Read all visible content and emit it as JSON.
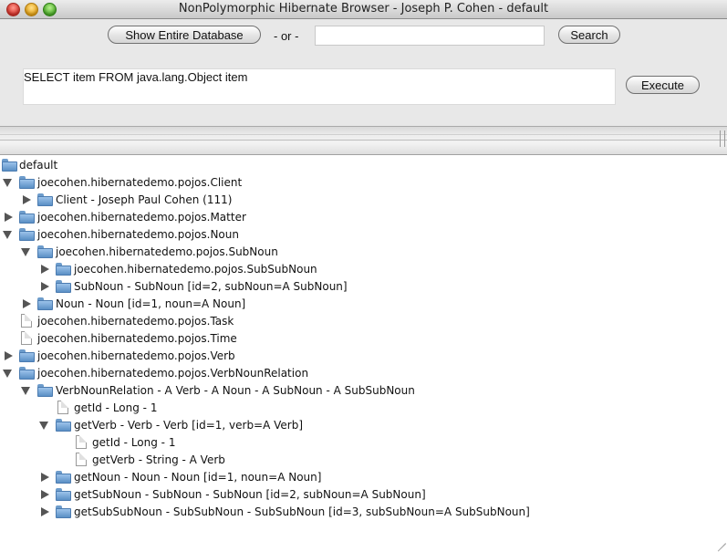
{
  "window": {
    "title": "NonPolymorphic Hibernate Browser - Joseph P. Cohen - default"
  },
  "toolbar": {
    "show_all_label": "Show Entire Database",
    "or_label": "- or -",
    "search_value": "",
    "search_label": "Search",
    "query_text": "SELECT item FROM java.lang.Object item",
    "execute_label": "Execute"
  },
  "tree": [
    {
      "label": "default",
      "depth": 0,
      "icon": "folder-icon",
      "toggle": "none"
    },
    {
      "label": "joecohen.hibernatedemo.pojos.Client",
      "depth": 0,
      "icon": "folder-icon",
      "toggle": "expanded"
    },
    {
      "label": "Client - Joseph Paul Cohen (111)",
      "depth": 1,
      "icon": "folder-icon",
      "toggle": "collapsed"
    },
    {
      "label": "joecohen.hibernatedemo.pojos.Matter",
      "depth": 0,
      "icon": "folder-icon",
      "toggle": "collapsed"
    },
    {
      "label": "joecohen.hibernatedemo.pojos.Noun",
      "depth": 0,
      "icon": "folder-icon",
      "toggle": "expanded"
    },
    {
      "label": "joecohen.hibernatedemo.pojos.SubNoun",
      "depth": 1,
      "icon": "folder-icon",
      "toggle": "expanded"
    },
    {
      "label": "joecohen.hibernatedemo.pojos.SubSubNoun",
      "depth": 2,
      "icon": "folder-icon",
      "toggle": "collapsed"
    },
    {
      "label": "SubNoun - SubNoun [id=2, subNoun=A SubNoun]",
      "depth": 2,
      "icon": "folder-icon",
      "toggle": "collapsed"
    },
    {
      "label": "Noun - Noun [id=1, noun=A Noun]",
      "depth": 1,
      "icon": "folder-icon",
      "toggle": "collapsed"
    },
    {
      "label": "joecohen.hibernatedemo.pojos.Task",
      "depth": 0,
      "icon": "document-icon",
      "toggle": "none"
    },
    {
      "label": "joecohen.hibernatedemo.pojos.Time",
      "depth": 0,
      "icon": "document-icon",
      "toggle": "none"
    },
    {
      "label": "joecohen.hibernatedemo.pojos.Verb",
      "depth": 0,
      "icon": "folder-icon",
      "toggle": "collapsed"
    },
    {
      "label": "joecohen.hibernatedemo.pojos.VerbNounRelation",
      "depth": 0,
      "icon": "folder-icon",
      "toggle": "expanded"
    },
    {
      "label": "VerbNounRelation - A Verb - A Noun - A SubNoun - A SubSubNoun",
      "depth": 1,
      "icon": "folder-icon",
      "toggle": "expanded"
    },
    {
      "label": "getId - Long - 1",
      "depth": 2,
      "icon": "document-icon",
      "toggle": "none"
    },
    {
      "label": "getVerb - Verb - Verb [id=1, verb=A Verb]",
      "depth": 2,
      "icon": "folder-icon",
      "toggle": "expanded"
    },
    {
      "label": "getId - Long - 1",
      "depth": 3,
      "icon": "document-icon",
      "toggle": "none"
    },
    {
      "label": "getVerb - String - A Verb",
      "depth": 3,
      "icon": "document-icon",
      "toggle": "none"
    },
    {
      "label": "getNoun - Noun - Noun [id=1, noun=A Noun]",
      "depth": 2,
      "icon": "folder-icon",
      "toggle": "collapsed"
    },
    {
      "label": "getSubNoun - SubNoun - SubNoun [id=2, subNoun=A SubNoun]",
      "depth": 2,
      "icon": "folder-icon",
      "toggle": "collapsed"
    },
    {
      "label": "getSubSubNoun - SubSubNoun - SubSubNoun [id=3, subSubNoun=A SubSubNoun]",
      "depth": 2,
      "icon": "folder-icon",
      "toggle": "collapsed"
    }
  ]
}
